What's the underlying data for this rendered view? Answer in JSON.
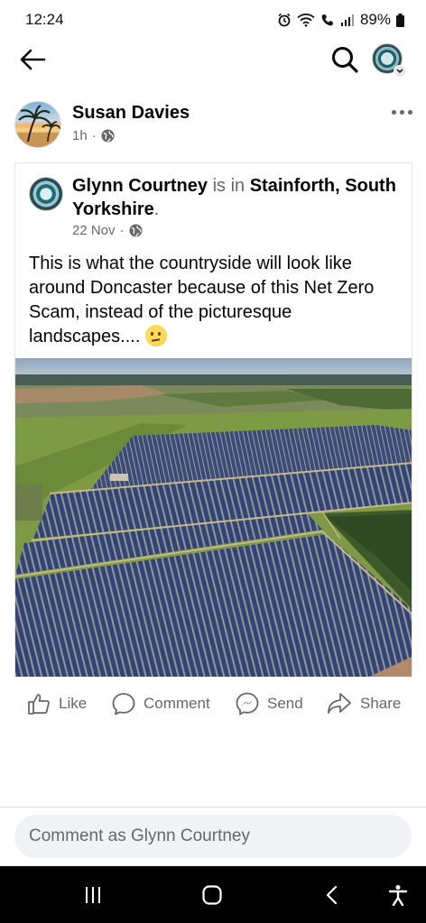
{
  "status": {
    "time": "12:24",
    "battery": "89%"
  },
  "post": {
    "author": "Susan Davies",
    "time": "1h"
  },
  "shared": {
    "author": "Glynn Courtney",
    "is_in": "is in",
    "location": "Stainforth, South Yorkshire",
    "period": ".",
    "date": "22 Nov",
    "text": "This is what the countryside will look like around Doncaster because of this Net Zero Scam, instead of the picturesque landscapes...."
  },
  "actions": {
    "like": "Like",
    "comment": "Comment",
    "send": "Send",
    "share": "Share"
  },
  "comment_input": {
    "placeholder": "Comment as Glynn Courtney"
  },
  "icons": {
    "back": "arrow-left-icon",
    "search": "search-icon",
    "more": "more-icon",
    "globe": "globe-icon",
    "like": "thumbs-up-icon",
    "comment": "comment-bubble-icon",
    "send": "messenger-icon",
    "share": "share-arrow-icon",
    "nav_recents": "recents-icon",
    "nav_home": "home-icon",
    "nav_back": "nav-back-icon",
    "nav_accessibility": "accessibility-icon"
  }
}
